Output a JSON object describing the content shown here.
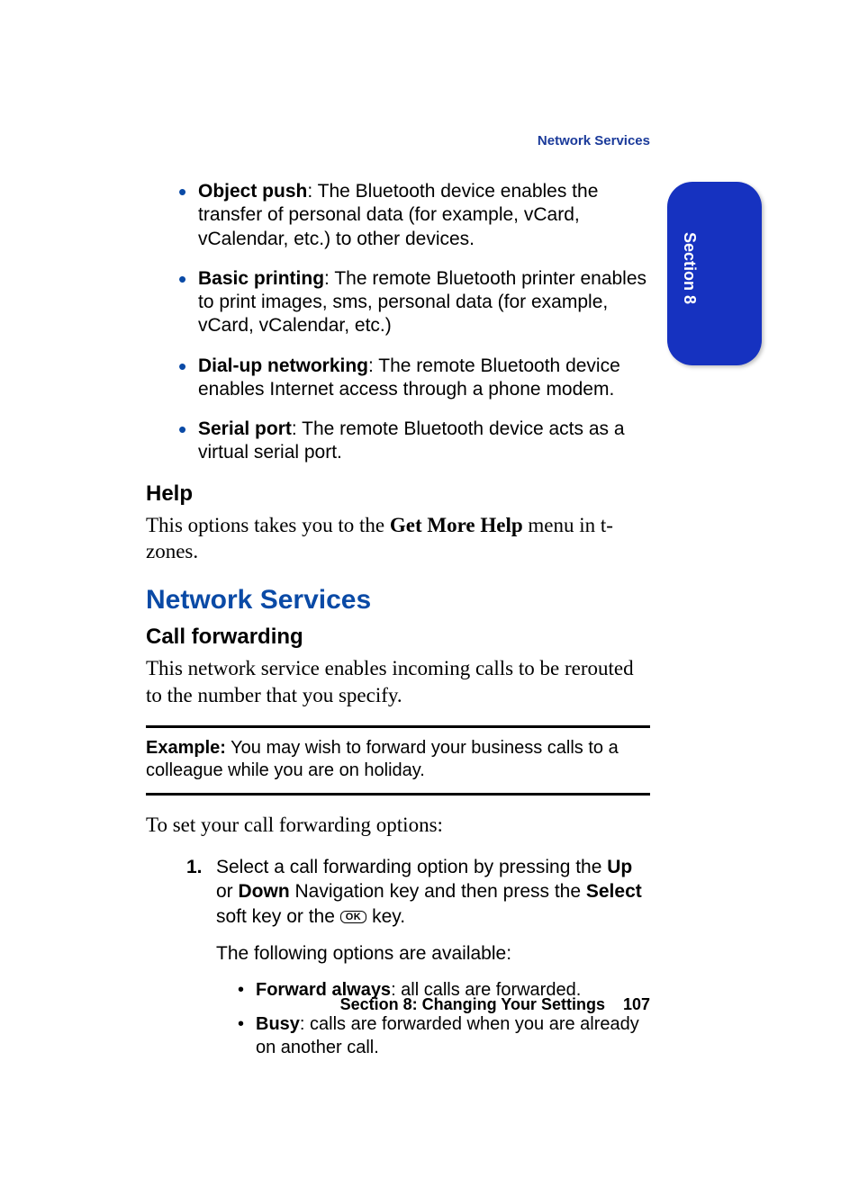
{
  "header": {
    "running": "Network Services"
  },
  "tab": {
    "label": "Section 8"
  },
  "bullets": [
    {
      "term": "Object push",
      "desc": ": The Bluetooth device enables the transfer of personal data (for example, vCard, vCalendar, etc.) to other devices."
    },
    {
      "term": "Basic printing",
      "desc": ": The remote Bluetooth printer enables to print images, sms, personal data (for example, vCard, vCalendar, etc.)"
    },
    {
      "term": "Dial-up networking",
      "desc": ": The remote Bluetooth device enables Internet access through a phone modem."
    },
    {
      "term": "Serial port",
      "desc": ": The remote Bluetooth device acts as a virtual serial port."
    }
  ],
  "help": {
    "heading": "Help",
    "text_a": "This options takes you to the ",
    "strong": "Get More Help",
    "text_b": " menu in t-zones."
  },
  "section": {
    "heading": "Network Services",
    "sub": "Call forwarding",
    "intro": "This network service enables incoming calls to be rerouted to the number that you specify."
  },
  "example": {
    "label": "Example:",
    "text": " You may wish to forward your business calls to a colleague while you are on holiday."
  },
  "howto": "To set your call forwarding options:",
  "step1": {
    "num": "1.",
    "a": "Select a call forwarding option by pressing the ",
    "up": "Up",
    "b": " or ",
    "down": "Down",
    "c": " Navigation key and then press the ",
    "select": "Select",
    "d": " soft key or the ",
    "ok": "OK",
    "e": " key.",
    "avail": "The following options are available:",
    "opts": [
      {
        "term": "Forward always",
        "desc": ": all calls are forwarded."
      },
      {
        "term": "Busy",
        "desc": ": calls are forwarded when you are already on another call."
      }
    ]
  },
  "footer": {
    "section": "Section 8: Changing Your Settings",
    "page": "107"
  }
}
